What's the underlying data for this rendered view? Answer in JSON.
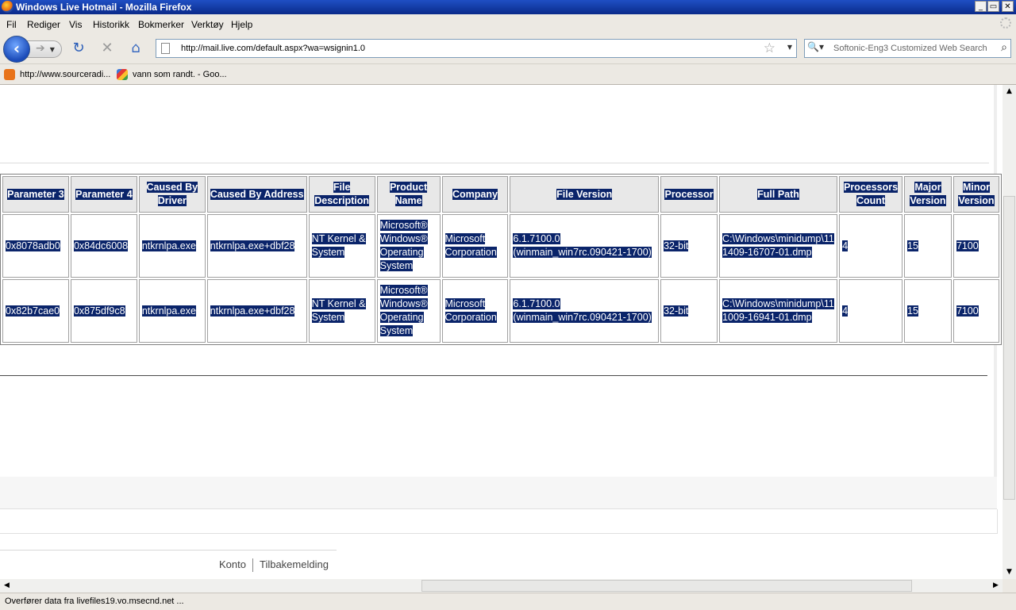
{
  "window": {
    "title": "Windows Live Hotmail - Mozilla Firefox",
    "controls": {
      "minimize": "_",
      "maximize": "▭",
      "close": "✕"
    }
  },
  "menu": [
    "Fil",
    "Rediger",
    "Vis",
    "Historikk",
    "Bokmerker",
    "Verktøy",
    "Hjelp"
  ],
  "nav": {
    "url": "http://mail.live.com/default.aspx?wa=wsignin1.0",
    "search_placeholder": "Softonic-Eng3 Customized Web Search",
    "icons": [
      "back-icon",
      "forward-icon",
      "reload-icon",
      "stop-icon",
      "home-icon",
      "star-icon",
      "search-icon"
    ]
  },
  "bookmarks": [
    {
      "label": "http://www.sourceradi...",
      "icon": "rss-feed-icon",
      "color": "#e8731a"
    },
    {
      "label": "vann som randt. - Goo...",
      "icon": "google-icon",
      "color": "#3c78d8"
    }
  ],
  "table": {
    "headers": [
      "Parameter 3",
      "Parameter 4",
      "Caused By Driver",
      "Caused By Address",
      "File Description",
      "Product Name",
      "Company",
      "File Version",
      "Processor",
      "Full Path",
      "Processors Count",
      "Major Version",
      "Minor Version"
    ],
    "rows": [
      [
        "0x8078adb0",
        "0x84dc6008",
        "ntkrnlpa.exe",
        "ntkrnlpa.exe+dbf28",
        "NT Kernel & System",
        "Microsoft® Windows® Operating System",
        "Microsoft Corporation",
        "6.1.7100.0 (winmain_win7rc.090421-1700)",
        "32-bit",
        "C:\\Windows\\minidump\\111409-16707-01.dmp",
        "4",
        "15",
        "7100"
      ],
      [
        "0x82b7cae0",
        "0x875df9c8",
        "ntkrnlpa.exe",
        "ntkrnlpa.exe+dbf28",
        "NT Kernel & System",
        "Microsoft® Windows® Operating System",
        "Microsoft Corporation",
        "6.1.7100.0 (winmain_win7rc.090421-1700)",
        "32-bit",
        "C:\\Windows\\minidump\\111009-16941-01.dmp",
        "4",
        "15",
        "7100"
      ]
    ]
  },
  "footer": {
    "links": [
      "Konto",
      "Tilbakemelding"
    ]
  },
  "status": "Overfører data fra livefiles19.vo.msecnd.net ...",
  "colors": {
    "selection": "#0a246a",
    "titlebar": "#0a2a8a",
    "chrome": "#ece9e3"
  }
}
